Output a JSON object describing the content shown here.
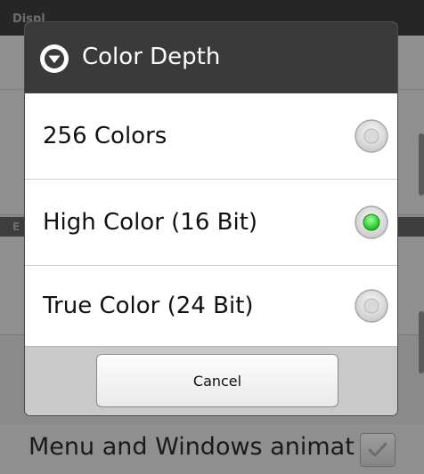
{
  "background": {
    "header_label": "Displ",
    "section_label": "E",
    "menu_item_label": "Menu and Windows animat",
    "menu_item_checked": true
  },
  "dialog": {
    "title": "Color Depth",
    "title_icon": "circle-chevron-down-icon",
    "options": [
      {
        "label": "256 Colors",
        "selected": false
      },
      {
        "label": "High Color (16 Bit)",
        "selected": true
      },
      {
        "label": "True Color (24 Bit)",
        "selected": false
      }
    ],
    "cancel_label": "Cancel"
  },
  "colors": {
    "title_bar": "#3a3a3a",
    "radio_selected": "#2bd12b",
    "footer": "#c9c9c9"
  }
}
